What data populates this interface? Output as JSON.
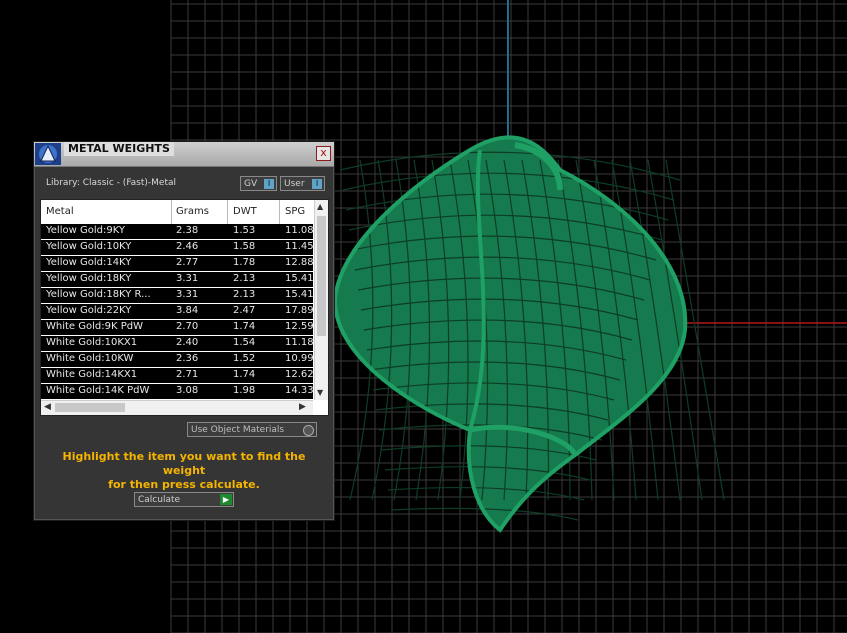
{
  "panel": {
    "title": "METAL WEIGHTS",
    "close_label": "x",
    "library_label": "Library: Classic - (Fast)-Metal",
    "gv_label": "GV",
    "user_label": "User",
    "toggle_glyph": "I",
    "use_object_materials_label": "Use Object Materials",
    "hint_line1": "Highlight the item you want to find the weight",
    "hint_line2": "for then press calculate.",
    "calculate_label": "Calculate",
    "calculate_glyph": "▶"
  },
  "table": {
    "headers": [
      "Metal",
      "Grams",
      "DWT",
      "SPG"
    ],
    "rows": [
      [
        "Yellow Gold:9KY",
        "2.38",
        "1.53",
        "11.08"
      ],
      [
        "Yellow Gold:10KY",
        "2.46",
        "1.58",
        "11.45"
      ],
      [
        "Yellow Gold:14KY",
        "2.77",
        "1.78",
        "12.88"
      ],
      [
        "Yellow Gold:18KY",
        "3.31",
        "2.13",
        "15.41"
      ],
      [
        "Yellow Gold:18KY R...",
        "3.31",
        "2.13",
        "15.41"
      ],
      [
        "Yellow Gold:22KY",
        "3.84",
        "2.47",
        "17.89"
      ],
      [
        "White Gold:9K PdW",
        "2.70",
        "1.74",
        "12.59"
      ],
      [
        "White Gold:10KX1",
        "2.40",
        "1.54",
        "11.18"
      ],
      [
        "White Gold:10KW",
        "2.36",
        "1.52",
        "10.99"
      ],
      [
        "White Gold:14KX1",
        "2.71",
        "1.74",
        "12.62"
      ],
      [
        "White Gold:14K PdW",
        "3.08",
        "1.98",
        "14.33"
      ]
    ]
  },
  "viewport": {
    "background": "#000000",
    "grid_color": "#3a3a3a",
    "axis_x_color": "#b01818",
    "axis_y_color": "#1d6f8a",
    "model_color": "#1e8a5a"
  }
}
